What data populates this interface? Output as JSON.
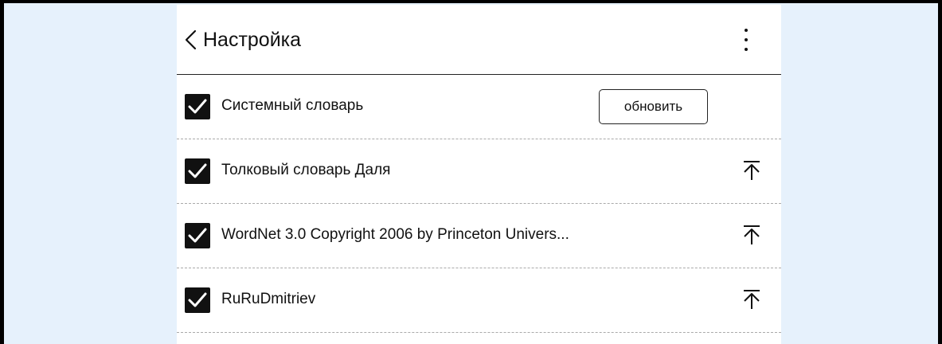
{
  "header": {
    "title": "Настройка",
    "back_icon": "chevron-left-icon",
    "menu_icon": "more-vertical-icon"
  },
  "dictionaries": [
    {
      "label": "Системный словарь",
      "checked": true,
      "action_label": "обновить"
    },
    {
      "label": "Толковый словарь Даля",
      "checked": true,
      "action_icon": "move-to-top-icon"
    },
    {
      "label": "WordNet 3.0 Copyright 2006 by Princeton Univers...",
      "checked": true,
      "action_icon": "move-to-top-icon"
    },
    {
      "label": "RuRuDmitriev",
      "checked": true,
      "action_icon": "move-to-top-icon"
    }
  ],
  "colors": {
    "background": "#e6f1fc",
    "panel": "#ffffff",
    "ink": "#111111"
  }
}
